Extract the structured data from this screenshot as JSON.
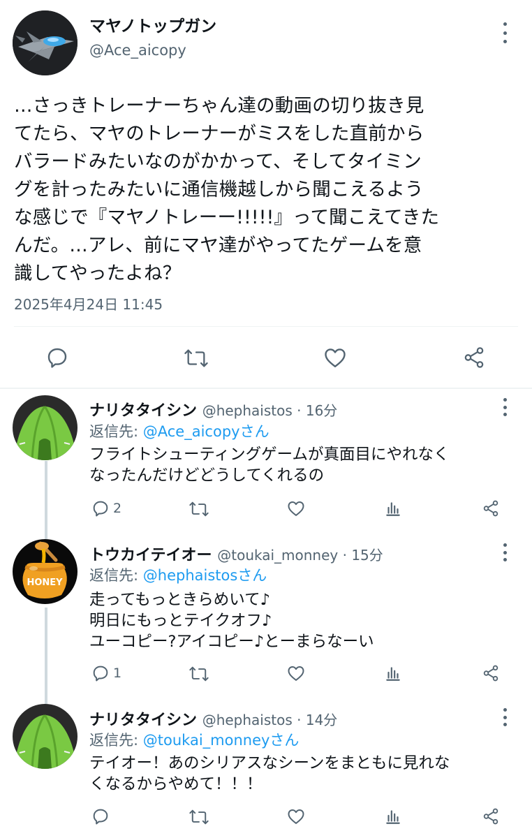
{
  "main_tweet": {
    "display_name": "マヤノトップガン",
    "handle": "@Ace_aicopy",
    "text_lines": [
      "…さっきトレーナーちゃん達の動画の切り抜き見",
      "てたら、マヤのトレーナーがミスをした直前から",
      "バラードみたいなのがかかって、そしてタイミン",
      "グを計ったみたいに通信機越しから聞こえるよう",
      "な感じで『マヤノトレーー!!!!!』って聞こえてきた",
      "んだ。…アレ、前にマヤ達がやってたゲームを意",
      "識してやったよね？"
    ],
    "timestamp": "2025年4月24日 11:45",
    "actions": [
      "reply-icon",
      "retweet-icon",
      "like-icon",
      "share-icon"
    ]
  },
  "replies": [
    {
      "display_name": "ナリタタイシン",
      "handle_time": "@hephaistos · 16分",
      "reply_prefix": "返信先: ",
      "reply_to": "@Ace_aicopyさん",
      "text_lines": [
        "フライトシューティングゲームが真面目にやれなく",
        "なったんだけどどうしてくれるの"
      ],
      "reply_count": "2",
      "avatar": "green-tent-avatar"
    },
    {
      "display_name": "トウカイテイオー",
      "handle_time": "@toukai_monney · 15分",
      "reply_prefix": "返信先: ",
      "reply_to": "@hephaistosさん",
      "text_lines": [
        "走ってもっときらめいて♪",
        "明日にもっとテイクオフ♪",
        "ユーコピー?アイコピー♪とーまらなーい"
      ],
      "reply_count": "1",
      "avatar": "honey-pot-avatar",
      "honey_label": "HONEY"
    },
    {
      "display_name": "ナリタタイシン",
      "handle_time": "@hephaistos · 14分",
      "reply_prefix": "返信先: ",
      "reply_to": "@toukai_monneyさん",
      "text_lines": [
        "テイオー！あのシリアスなシーンをまともに見れな",
        "くなるからやめて！！！"
      ],
      "reply_count": "",
      "avatar": "green-tent-avatar"
    }
  ],
  "colors": {
    "text": "#0f1419",
    "secondary": "#536471",
    "link": "#1d9bf0",
    "divider": "#eff3f4",
    "thread_line": "#cfd9de"
  }
}
